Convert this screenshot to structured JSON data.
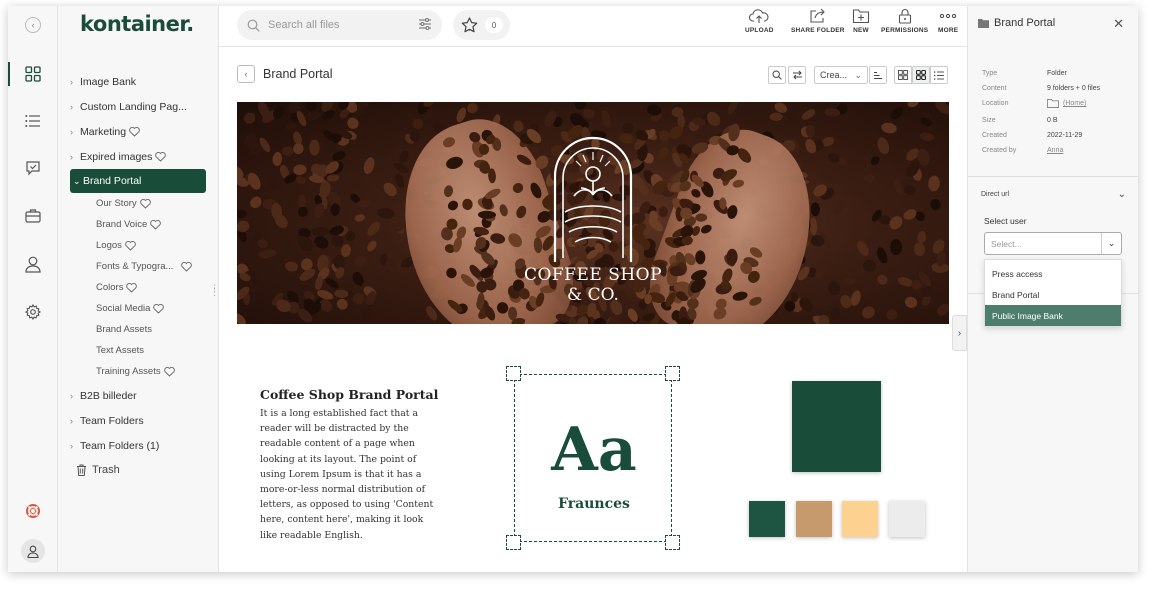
{
  "app": {
    "logo": "kontainer."
  },
  "search": {
    "placeholder": "Search all files"
  },
  "favorites": {
    "count": "0"
  },
  "toolbar": {
    "upload": "UPLOAD",
    "share_folder": "SHARE FOLDER",
    "new": "NEW",
    "permissions": "PERMISSIONS",
    "more": "MORE"
  },
  "sidebar": {
    "items": [
      {
        "label": "Image Bank"
      },
      {
        "label": "Custom Landing Pag..."
      },
      {
        "label": "Marketing"
      },
      {
        "label": "Expired images"
      },
      {
        "label": "Brand Portal"
      },
      {
        "label": "B2B billeder"
      },
      {
        "label": "Team Folders"
      },
      {
        "label": "Team Folders (1)"
      }
    ],
    "children": [
      {
        "label": "Our Story"
      },
      {
        "label": "Brand Voice"
      },
      {
        "label": "Logos"
      },
      {
        "label": "Fonts & Typogra..."
      },
      {
        "label": "Colors"
      },
      {
        "label": "Social Media"
      },
      {
        "label": "Brand Assets"
      },
      {
        "label": "Text Assets"
      },
      {
        "label": "Training Assets"
      }
    ],
    "trash": "Trash"
  },
  "content": {
    "breadcrumb": "Brand Portal",
    "sort_label": "Crea..."
  },
  "banner": {
    "line1": "COFFEE SHOP",
    "line2": "& CO.",
    "arc_text": "MORE THAN JUST COFFEE",
    "est_left": "E S T",
    "est_right": "20 23"
  },
  "portal": {
    "title": "Coffee Shop Brand Portal",
    "body": "It is a long established fact that a reader will be distracted by the readable content of a page when looking at its layout. The point of using Lorem Ipsum is that it has a more-or-less normal distribution of letters, as opposed to using 'Content here, content here', making it look like readable English.",
    "type_sample": "Aa",
    "font_name": "Fraunces"
  },
  "palette": {
    "primary": "#1a4c3a",
    "swatches": [
      "#1e5542",
      "#c69a6d",
      "#fdd291",
      "#ececec"
    ]
  },
  "info": {
    "title": "Brand Portal",
    "rows": [
      {
        "label": "Type",
        "value": "Folder"
      },
      {
        "label": "Content",
        "value": "9 folders + 0 files"
      },
      {
        "label": "Location",
        "value": "(Home)"
      },
      {
        "label": "Size",
        "value": "0 B"
      },
      {
        "label": "Created",
        "value": "2022-11-29"
      },
      {
        "label": "Created by",
        "value": "Anna"
      }
    ],
    "direct_url": "Direct url",
    "select_user": "Select user",
    "select_placeholder": "Select...",
    "options": [
      "Press access",
      "Brand Portal",
      "Public Image Bank"
    ]
  }
}
